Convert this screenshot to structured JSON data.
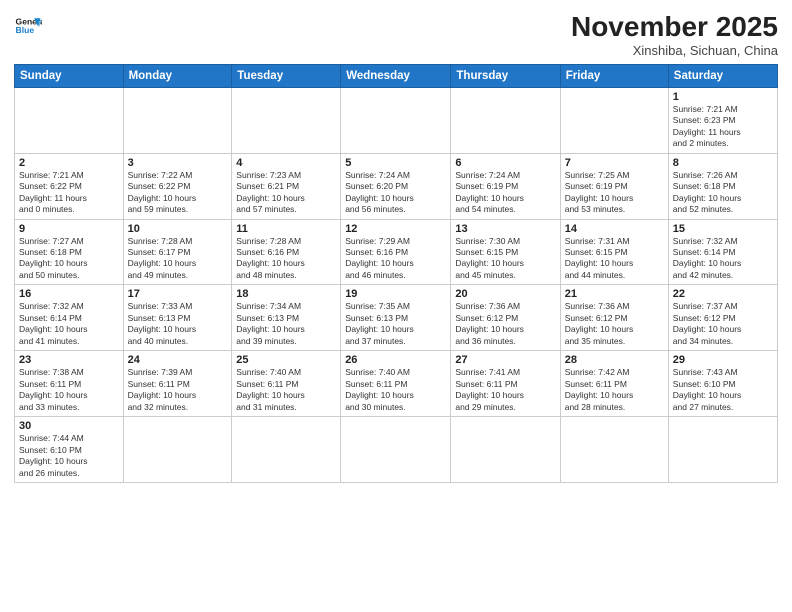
{
  "header": {
    "logo_general": "General",
    "logo_blue": "Blue",
    "month_title": "November 2025",
    "subtitle": "Xinshiba, Sichuan, China"
  },
  "days_of_week": [
    "Sunday",
    "Monday",
    "Tuesday",
    "Wednesday",
    "Thursday",
    "Friday",
    "Saturday"
  ],
  "weeks": [
    [
      {
        "day": "",
        "info": ""
      },
      {
        "day": "",
        "info": ""
      },
      {
        "day": "",
        "info": ""
      },
      {
        "day": "",
        "info": ""
      },
      {
        "day": "",
        "info": ""
      },
      {
        "day": "",
        "info": ""
      },
      {
        "day": "1",
        "info": "Sunrise: 7:21 AM\nSunset: 6:23 PM\nDaylight: 11 hours\nand 2 minutes."
      }
    ],
    [
      {
        "day": "2",
        "info": "Sunrise: 7:21 AM\nSunset: 6:22 PM\nDaylight: 11 hours\nand 0 minutes."
      },
      {
        "day": "3",
        "info": "Sunrise: 7:22 AM\nSunset: 6:22 PM\nDaylight: 10 hours\nand 59 minutes."
      },
      {
        "day": "4",
        "info": "Sunrise: 7:23 AM\nSunset: 6:21 PM\nDaylight: 10 hours\nand 57 minutes."
      },
      {
        "day": "5",
        "info": "Sunrise: 7:24 AM\nSunset: 6:20 PM\nDaylight: 10 hours\nand 56 minutes."
      },
      {
        "day": "6",
        "info": "Sunrise: 7:24 AM\nSunset: 6:19 PM\nDaylight: 10 hours\nand 54 minutes."
      },
      {
        "day": "7",
        "info": "Sunrise: 7:25 AM\nSunset: 6:19 PM\nDaylight: 10 hours\nand 53 minutes."
      },
      {
        "day": "8",
        "info": "Sunrise: 7:26 AM\nSunset: 6:18 PM\nDaylight: 10 hours\nand 52 minutes."
      }
    ],
    [
      {
        "day": "9",
        "info": "Sunrise: 7:27 AM\nSunset: 6:18 PM\nDaylight: 10 hours\nand 50 minutes."
      },
      {
        "day": "10",
        "info": "Sunrise: 7:28 AM\nSunset: 6:17 PM\nDaylight: 10 hours\nand 49 minutes."
      },
      {
        "day": "11",
        "info": "Sunrise: 7:28 AM\nSunset: 6:16 PM\nDaylight: 10 hours\nand 48 minutes."
      },
      {
        "day": "12",
        "info": "Sunrise: 7:29 AM\nSunset: 6:16 PM\nDaylight: 10 hours\nand 46 minutes."
      },
      {
        "day": "13",
        "info": "Sunrise: 7:30 AM\nSunset: 6:15 PM\nDaylight: 10 hours\nand 45 minutes."
      },
      {
        "day": "14",
        "info": "Sunrise: 7:31 AM\nSunset: 6:15 PM\nDaylight: 10 hours\nand 44 minutes."
      },
      {
        "day": "15",
        "info": "Sunrise: 7:32 AM\nSunset: 6:14 PM\nDaylight: 10 hours\nand 42 minutes."
      }
    ],
    [
      {
        "day": "16",
        "info": "Sunrise: 7:32 AM\nSunset: 6:14 PM\nDaylight: 10 hours\nand 41 minutes."
      },
      {
        "day": "17",
        "info": "Sunrise: 7:33 AM\nSunset: 6:13 PM\nDaylight: 10 hours\nand 40 minutes."
      },
      {
        "day": "18",
        "info": "Sunrise: 7:34 AM\nSunset: 6:13 PM\nDaylight: 10 hours\nand 39 minutes."
      },
      {
        "day": "19",
        "info": "Sunrise: 7:35 AM\nSunset: 6:13 PM\nDaylight: 10 hours\nand 37 minutes."
      },
      {
        "day": "20",
        "info": "Sunrise: 7:36 AM\nSunset: 6:12 PM\nDaylight: 10 hours\nand 36 minutes."
      },
      {
        "day": "21",
        "info": "Sunrise: 7:36 AM\nSunset: 6:12 PM\nDaylight: 10 hours\nand 35 minutes."
      },
      {
        "day": "22",
        "info": "Sunrise: 7:37 AM\nSunset: 6:12 PM\nDaylight: 10 hours\nand 34 minutes."
      }
    ],
    [
      {
        "day": "23",
        "info": "Sunrise: 7:38 AM\nSunset: 6:11 PM\nDaylight: 10 hours\nand 33 minutes."
      },
      {
        "day": "24",
        "info": "Sunrise: 7:39 AM\nSunset: 6:11 PM\nDaylight: 10 hours\nand 32 minutes."
      },
      {
        "day": "25",
        "info": "Sunrise: 7:40 AM\nSunset: 6:11 PM\nDaylight: 10 hours\nand 31 minutes."
      },
      {
        "day": "26",
        "info": "Sunrise: 7:40 AM\nSunset: 6:11 PM\nDaylight: 10 hours\nand 30 minutes."
      },
      {
        "day": "27",
        "info": "Sunrise: 7:41 AM\nSunset: 6:11 PM\nDaylight: 10 hours\nand 29 minutes."
      },
      {
        "day": "28",
        "info": "Sunrise: 7:42 AM\nSunset: 6:11 PM\nDaylight: 10 hours\nand 28 minutes."
      },
      {
        "day": "29",
        "info": "Sunrise: 7:43 AM\nSunset: 6:10 PM\nDaylight: 10 hours\nand 27 minutes."
      }
    ],
    [
      {
        "day": "30",
        "info": "Sunrise: 7:44 AM\nSunset: 6:10 PM\nDaylight: 10 hours\nand 26 minutes."
      },
      {
        "day": "",
        "info": ""
      },
      {
        "day": "",
        "info": ""
      },
      {
        "day": "",
        "info": ""
      },
      {
        "day": "",
        "info": ""
      },
      {
        "day": "",
        "info": ""
      },
      {
        "day": "",
        "info": ""
      }
    ]
  ]
}
